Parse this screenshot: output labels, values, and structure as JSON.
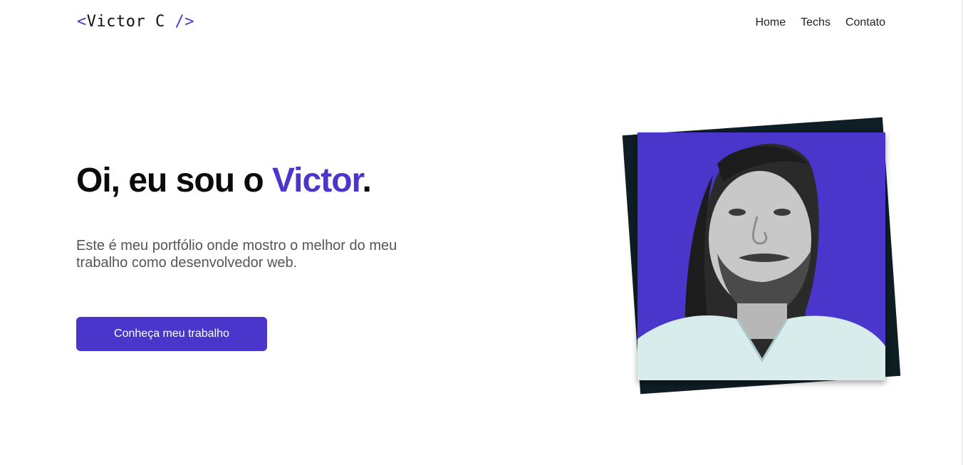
{
  "header": {
    "logo_prefix": "<",
    "logo_name": "Victor C",
    "logo_suffix": " />",
    "nav": [
      {
        "label": "Home"
      },
      {
        "label": "Techs"
      },
      {
        "label": "Contato"
      }
    ]
  },
  "hero": {
    "title_prefix": "Oi, eu sou o ",
    "title_name": "Victor",
    "title_suffix": ".",
    "description": "Este é meu portfólio onde mostro o melhor do meu trabalho como desenvolvedor web.",
    "cta_label": "Conheça meu trabalho"
  },
  "colors": {
    "accent": "#4b36cc",
    "photo_back": "#0e1e24",
    "text_dark": "#0b0b0b",
    "text_muted": "#555555"
  },
  "icons": {
    "photo": "profile-photo"
  }
}
